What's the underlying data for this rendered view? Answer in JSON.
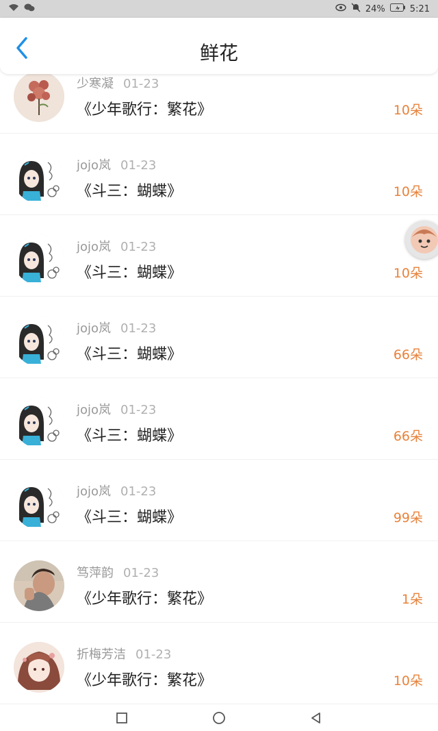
{
  "status_bar": {
    "battery": "24%",
    "time": "5:21"
  },
  "header": {
    "title": "鲜花"
  },
  "items": [
    {
      "user": "少寒凝",
      "date": "01-23",
      "gift": "《少年歌行：繁花》",
      "count": "10朵",
      "avatar": "rose"
    },
    {
      "user": "jojo岚",
      "date": "01-23",
      "gift": "《斗三：蝴蝶》",
      "count": "10朵",
      "avatar": "anime"
    },
    {
      "user": "jojo岚",
      "date": "01-23",
      "gift": "《斗三：蝴蝶》",
      "count": "10朵",
      "avatar": "anime"
    },
    {
      "user": "jojo岚",
      "date": "01-23",
      "gift": "《斗三：蝴蝶》",
      "count": "66朵",
      "avatar": "anime"
    },
    {
      "user": "jojo岚",
      "date": "01-23",
      "gift": "《斗三：蝴蝶》",
      "count": "66朵",
      "avatar": "anime"
    },
    {
      "user": "jojo岚",
      "date": "01-23",
      "gift": "《斗三：蝴蝶》",
      "count": "99朵",
      "avatar": "anime"
    },
    {
      "user": "笃萍韵",
      "date": "01-23",
      "gift": "《少年歌行：繁花》",
      "count": "1朵",
      "avatar": "photo"
    },
    {
      "user": "折梅芳洁",
      "date": "01-23",
      "gift": "《少年歌行：繁花》",
      "count": "10朵",
      "avatar": "girl"
    }
  ],
  "colors": {
    "accent": "#e8823a",
    "back_arrow": "#1e90e6"
  }
}
